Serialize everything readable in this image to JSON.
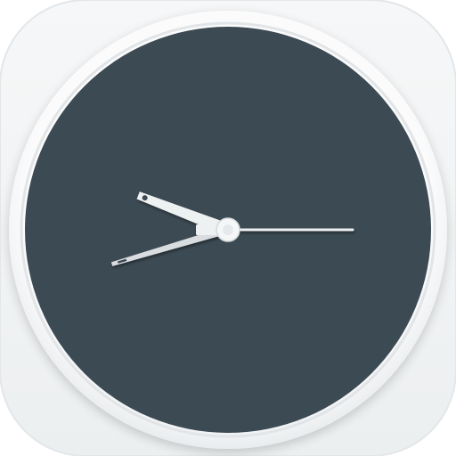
{
  "app_icon": {
    "name": "clock",
    "colors": {
      "tile": "#f1f3f4",
      "tile_edge": "#e2e6e8",
      "bezel": "#f8f9fa",
      "bezel_shadow": "#d3d8db",
      "face": "#3c4a53",
      "hands": "#eef1f2",
      "hand_shadow": "#a9b1b6",
      "hub": "#f5f6f7"
    },
    "time_shown": {
      "hour": 9,
      "minute": 42,
      "second": 15
    }
  }
}
